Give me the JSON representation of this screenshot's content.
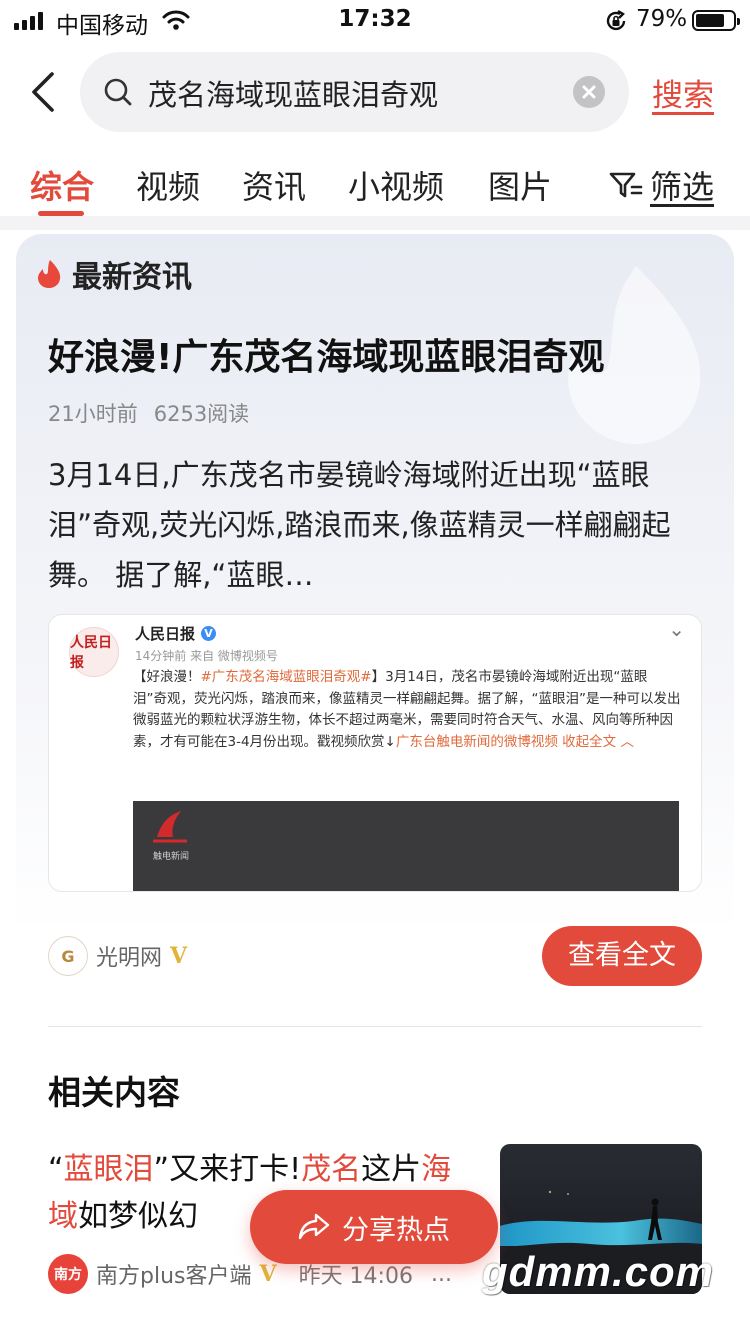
{
  "status_bar": {
    "carrier": "中国移动",
    "time": "17:32",
    "battery_percent": "79%",
    "battery_level": 0.79
  },
  "search": {
    "query": "茂名海域现蓝眼泪奇观",
    "submit_label": "搜索"
  },
  "tabs": [
    {
      "label": "综合",
      "active": true
    },
    {
      "label": "视频",
      "active": false
    },
    {
      "label": "资讯",
      "active": false
    },
    {
      "label": "小视频",
      "active": false
    },
    {
      "label": "图片",
      "active": false
    }
  ],
  "filter_label": "筛选",
  "news_card": {
    "section_label": "最新资讯",
    "title": "好浪漫!广东茂名海域现蓝眼泪奇观",
    "time_ago": "21小时前",
    "reads": "6253阅读",
    "summary": "3月14日,广东茂名市晏镜岭海域附近出现“蓝眼泪”奇观,荧光闪烁,踏浪而来,像蓝精灵一样翩翩起舞。 据了解,“蓝眼…",
    "embedded_post": {
      "account": "人民日报",
      "sub": "14分钟前 来自 微博视频号",
      "body_prefix": "【好浪漫！",
      "hashtag": "#广东茂名海域蓝眼泪奇观#",
      "body_main": "】3月14日，茂名市晏镜岭海域附近出现“蓝眼泪”奇观，荧光闪烁，踏浪而来，像蓝精灵一样翩翩起舞。据了解，“蓝眼泪”是一种可以发出微弱蓝光的颗粒状浮游生物，体长不超过两毫米，需要同时符合天气、水温、风向等所种因素，才有可能在3-4月份出现。戳视频欣赏↓",
      "body_link": "广东台触电新闻的微博视频 收起全文 ︿",
      "video_caption": "触电新闻"
    },
    "source_name": "光明网",
    "source_verified": "V",
    "read_full_label": "查看全文"
  },
  "related": {
    "heading": "相关内容",
    "title_parts": [
      {
        "text": "“",
        "hl": false
      },
      {
        "text": "蓝眼泪",
        "hl": true
      },
      {
        "text": "”又来打卡!",
        "hl": false
      },
      {
        "text": "茂名",
        "hl": true
      },
      {
        "text": "这片",
        "hl": false
      },
      {
        "text": "海域",
        "hl": true
      },
      {
        "text": "如梦似幻",
        "hl": false
      }
    ],
    "source_name": "南方plus客户端",
    "source_verified": "V",
    "time": "昨天 14:06",
    "more": "..."
  },
  "share_label": "分享热点",
  "watermark": "gdmm.com",
  "colors": {
    "accent": "#e24a3c",
    "verified": "#e0b43c",
    "hashtag": "#e06a3b"
  }
}
